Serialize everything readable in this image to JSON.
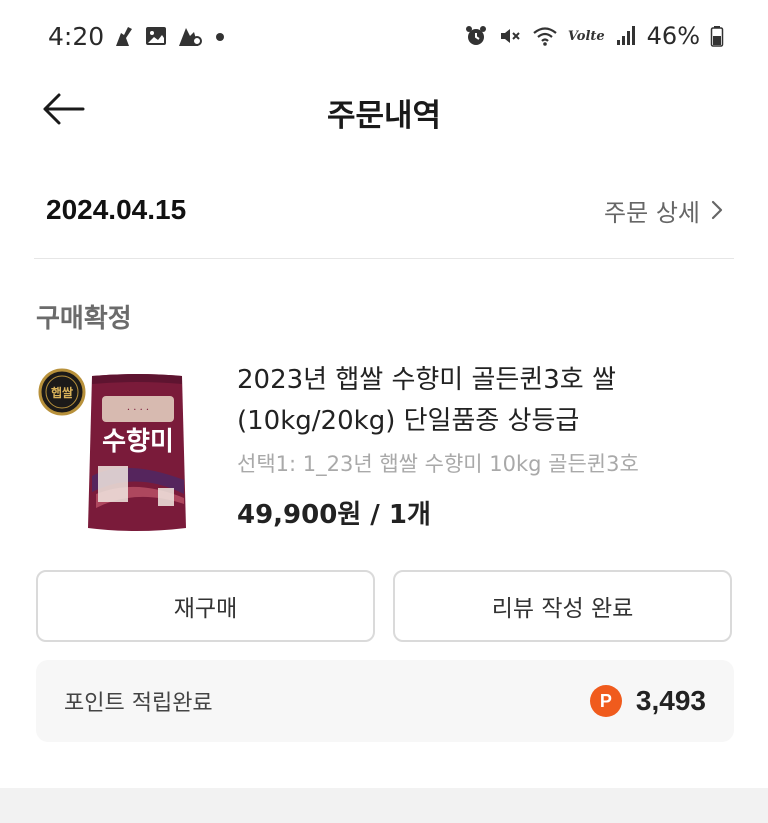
{
  "status_bar": {
    "time": "4:20",
    "battery": "46%",
    "network": "Volte",
    "left_icons": [
      "silhouette-icon",
      "gallery-icon",
      "app-icon"
    ],
    "right_icons": [
      "alarm-icon",
      "mute-icon",
      "wifi-icon",
      "signal-icon",
      "battery-icon"
    ]
  },
  "header": {
    "title": "주문내역",
    "back_icon": "arrow-left-icon"
  },
  "order": {
    "date": "2024.04.15",
    "detail_link": "주문 상세"
  },
  "status": "구매확정",
  "product": {
    "badge": "햅쌀",
    "name": "2023년 햅쌀 수향미 골든퀸3호 쌀 (10kg/20kg) 단일품종 상등급",
    "option": "선택1: 1_23년 햅쌀 수향미 10kg 골든퀸3호",
    "price": "49,900원 / 1개",
    "bag_title": "수향미"
  },
  "buttons": {
    "rebuy": "재구매",
    "review": "리뷰 작성 완료"
  },
  "points": {
    "label": "포인트 적립완료",
    "badge": "P",
    "value": "3,493"
  },
  "colors": {
    "accent": "#f05b1d",
    "bag": "#7a1b3a"
  }
}
